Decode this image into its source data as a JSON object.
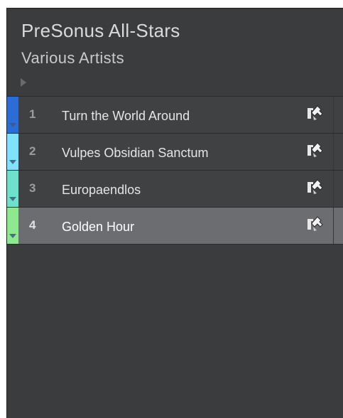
{
  "album": {
    "title": "PreSonus All-Stars",
    "artist": "Various Artists"
  },
  "tracks": [
    {
      "number": "1",
      "name": "Turn the World Around",
      "color": "#2b6cd6",
      "selected": false
    },
    {
      "number": "2",
      "name": "Vulpes Obsidian Sanctum",
      "color": "#7fe3ff",
      "selected": false
    },
    {
      "number": "3",
      "name": "Europaendlos",
      "color": "#6fe0cc",
      "selected": false
    },
    {
      "number": "4",
      "name": "Golden Hour",
      "color": "#8ee890",
      "selected": true
    }
  ],
  "icons": {
    "expand": "expand-triangle-icon",
    "track_action": "edit-song-icon"
  },
  "colors": {
    "panel_bg": "#3b3c3e",
    "row_bg": "#404143",
    "row_selected_bg": "#6c6d70"
  }
}
